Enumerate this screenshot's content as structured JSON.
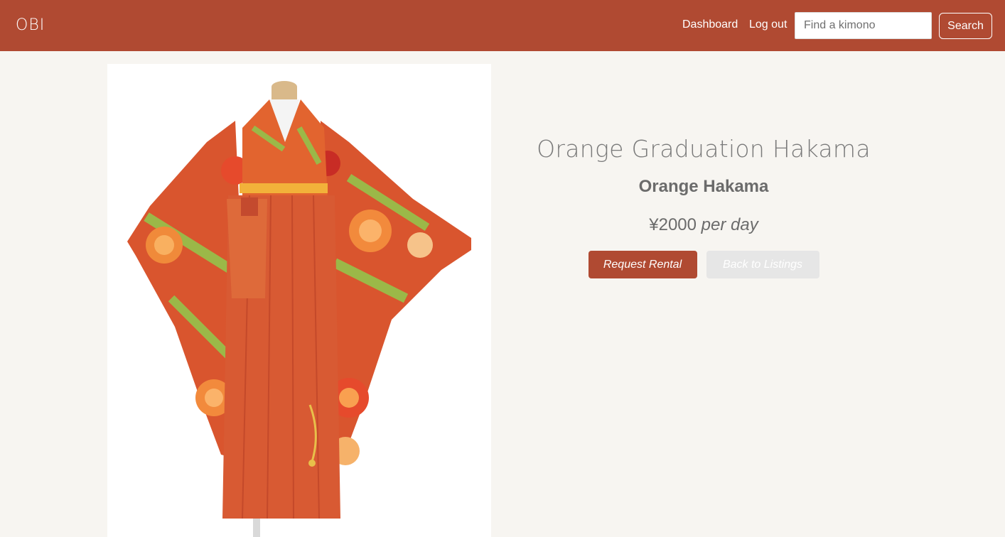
{
  "navbar": {
    "logo": "OBI",
    "links": {
      "dashboard": "Dashboard",
      "logout": "Log out"
    },
    "search": {
      "placeholder": "Find a kimono",
      "button_label": "Search"
    }
  },
  "product": {
    "title": "Orange Graduation Hakama",
    "subtitle": "Orange Hakama",
    "price": "¥2000",
    "price_unit": "per day",
    "actions": {
      "request": "Request Rental",
      "back": "Back to Listings"
    }
  },
  "colors": {
    "brand": "#b04a32",
    "background": "#f7f5f1",
    "muted_button": "#e6e6e6"
  }
}
